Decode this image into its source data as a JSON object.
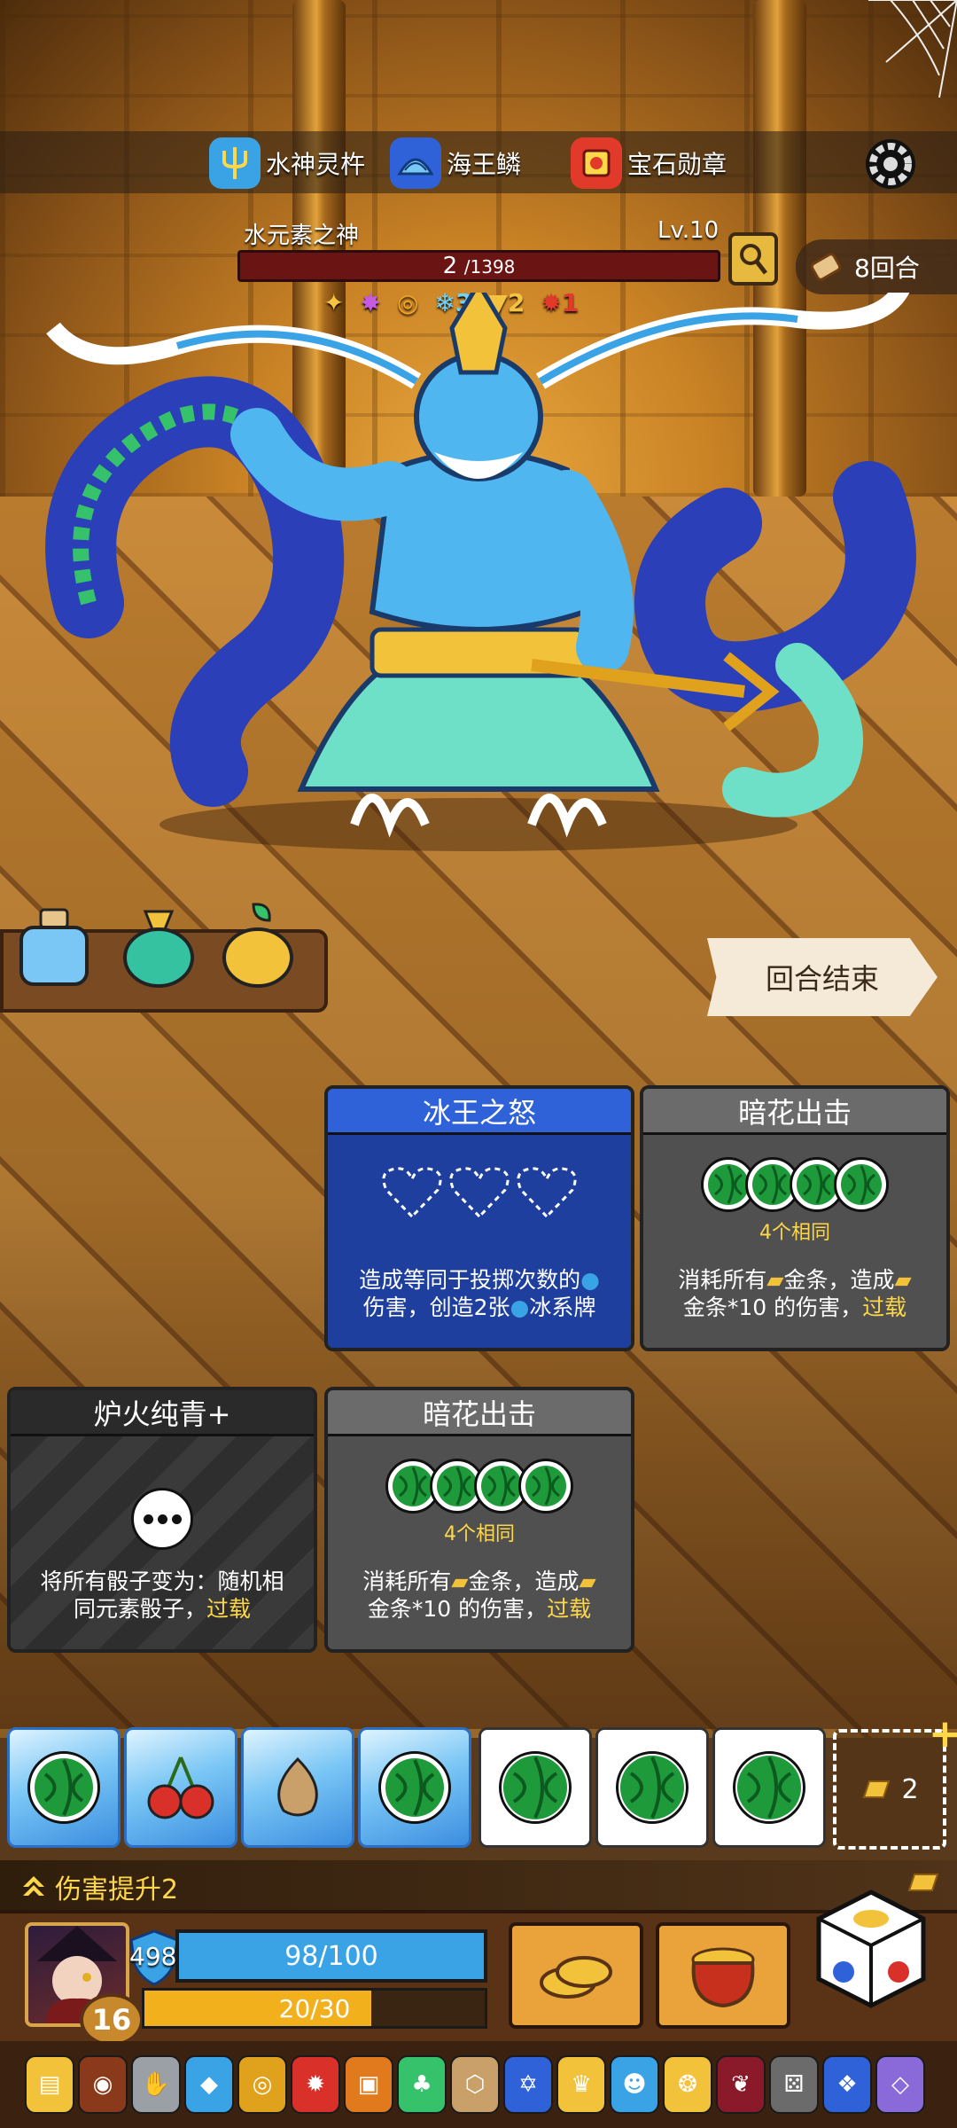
{
  "relics": [
    {
      "label": "水神灵杵",
      "icon": "water-trident-icon",
      "color": "#3aa3e6"
    },
    {
      "label": "海王鳞",
      "icon": "sea-scale-icon",
      "color": "#2f62d8"
    },
    {
      "label": "宝石勋章",
      "icon": "gem-medal-icon",
      "color": "#e23a2a"
    }
  ],
  "boss": {
    "name": "水元素之神",
    "level": "Lv.10",
    "hp_current": "2",
    "hp_text": "/1398",
    "status": [
      "",
      "",
      "",
      "3",
      "2",
      "1"
    ]
  },
  "round": {
    "label": "8回合"
  },
  "end_turn": {
    "label": "回合结束"
  },
  "cards": [
    {
      "title": "冰王之怒",
      "desc_line1": "造成等同于投掷次数的",
      "desc_line2": "伤害，创造2张",
      "desc_line2b": "冰系牌"
    },
    {
      "title": "暗花出击",
      "sub": "4个相同",
      "desc_line1a": "消耗所有",
      "desc_line1b": "金条，造成",
      "desc_line2": "金条*10 的伤害，",
      "overload": "过载"
    },
    {
      "title": "炉火纯青+",
      "desc_line1": "将所有骰子变为：随机相",
      "desc_line2": "同元素骰子，",
      "overload": "过载"
    },
    {
      "title": "暗花出击",
      "sub": "4个相同",
      "desc_line1a": "消耗所有",
      "desc_line1b": "金条，造成",
      "desc_line2": "金条*10 的伤害，",
      "overload": "过载"
    }
  ],
  "gold_slot": {
    "count": "2"
  },
  "damage_buff": {
    "label": "伤害提升2"
  },
  "player": {
    "shield": "498",
    "hp": "98/100",
    "xp": "20/30",
    "xp_fraction": 0.6667,
    "level": "16"
  },
  "colors": {
    "accent": "#ffd84a",
    "hp_blue": "#3aa3e6",
    "card_blue": "#2f62d8"
  }
}
